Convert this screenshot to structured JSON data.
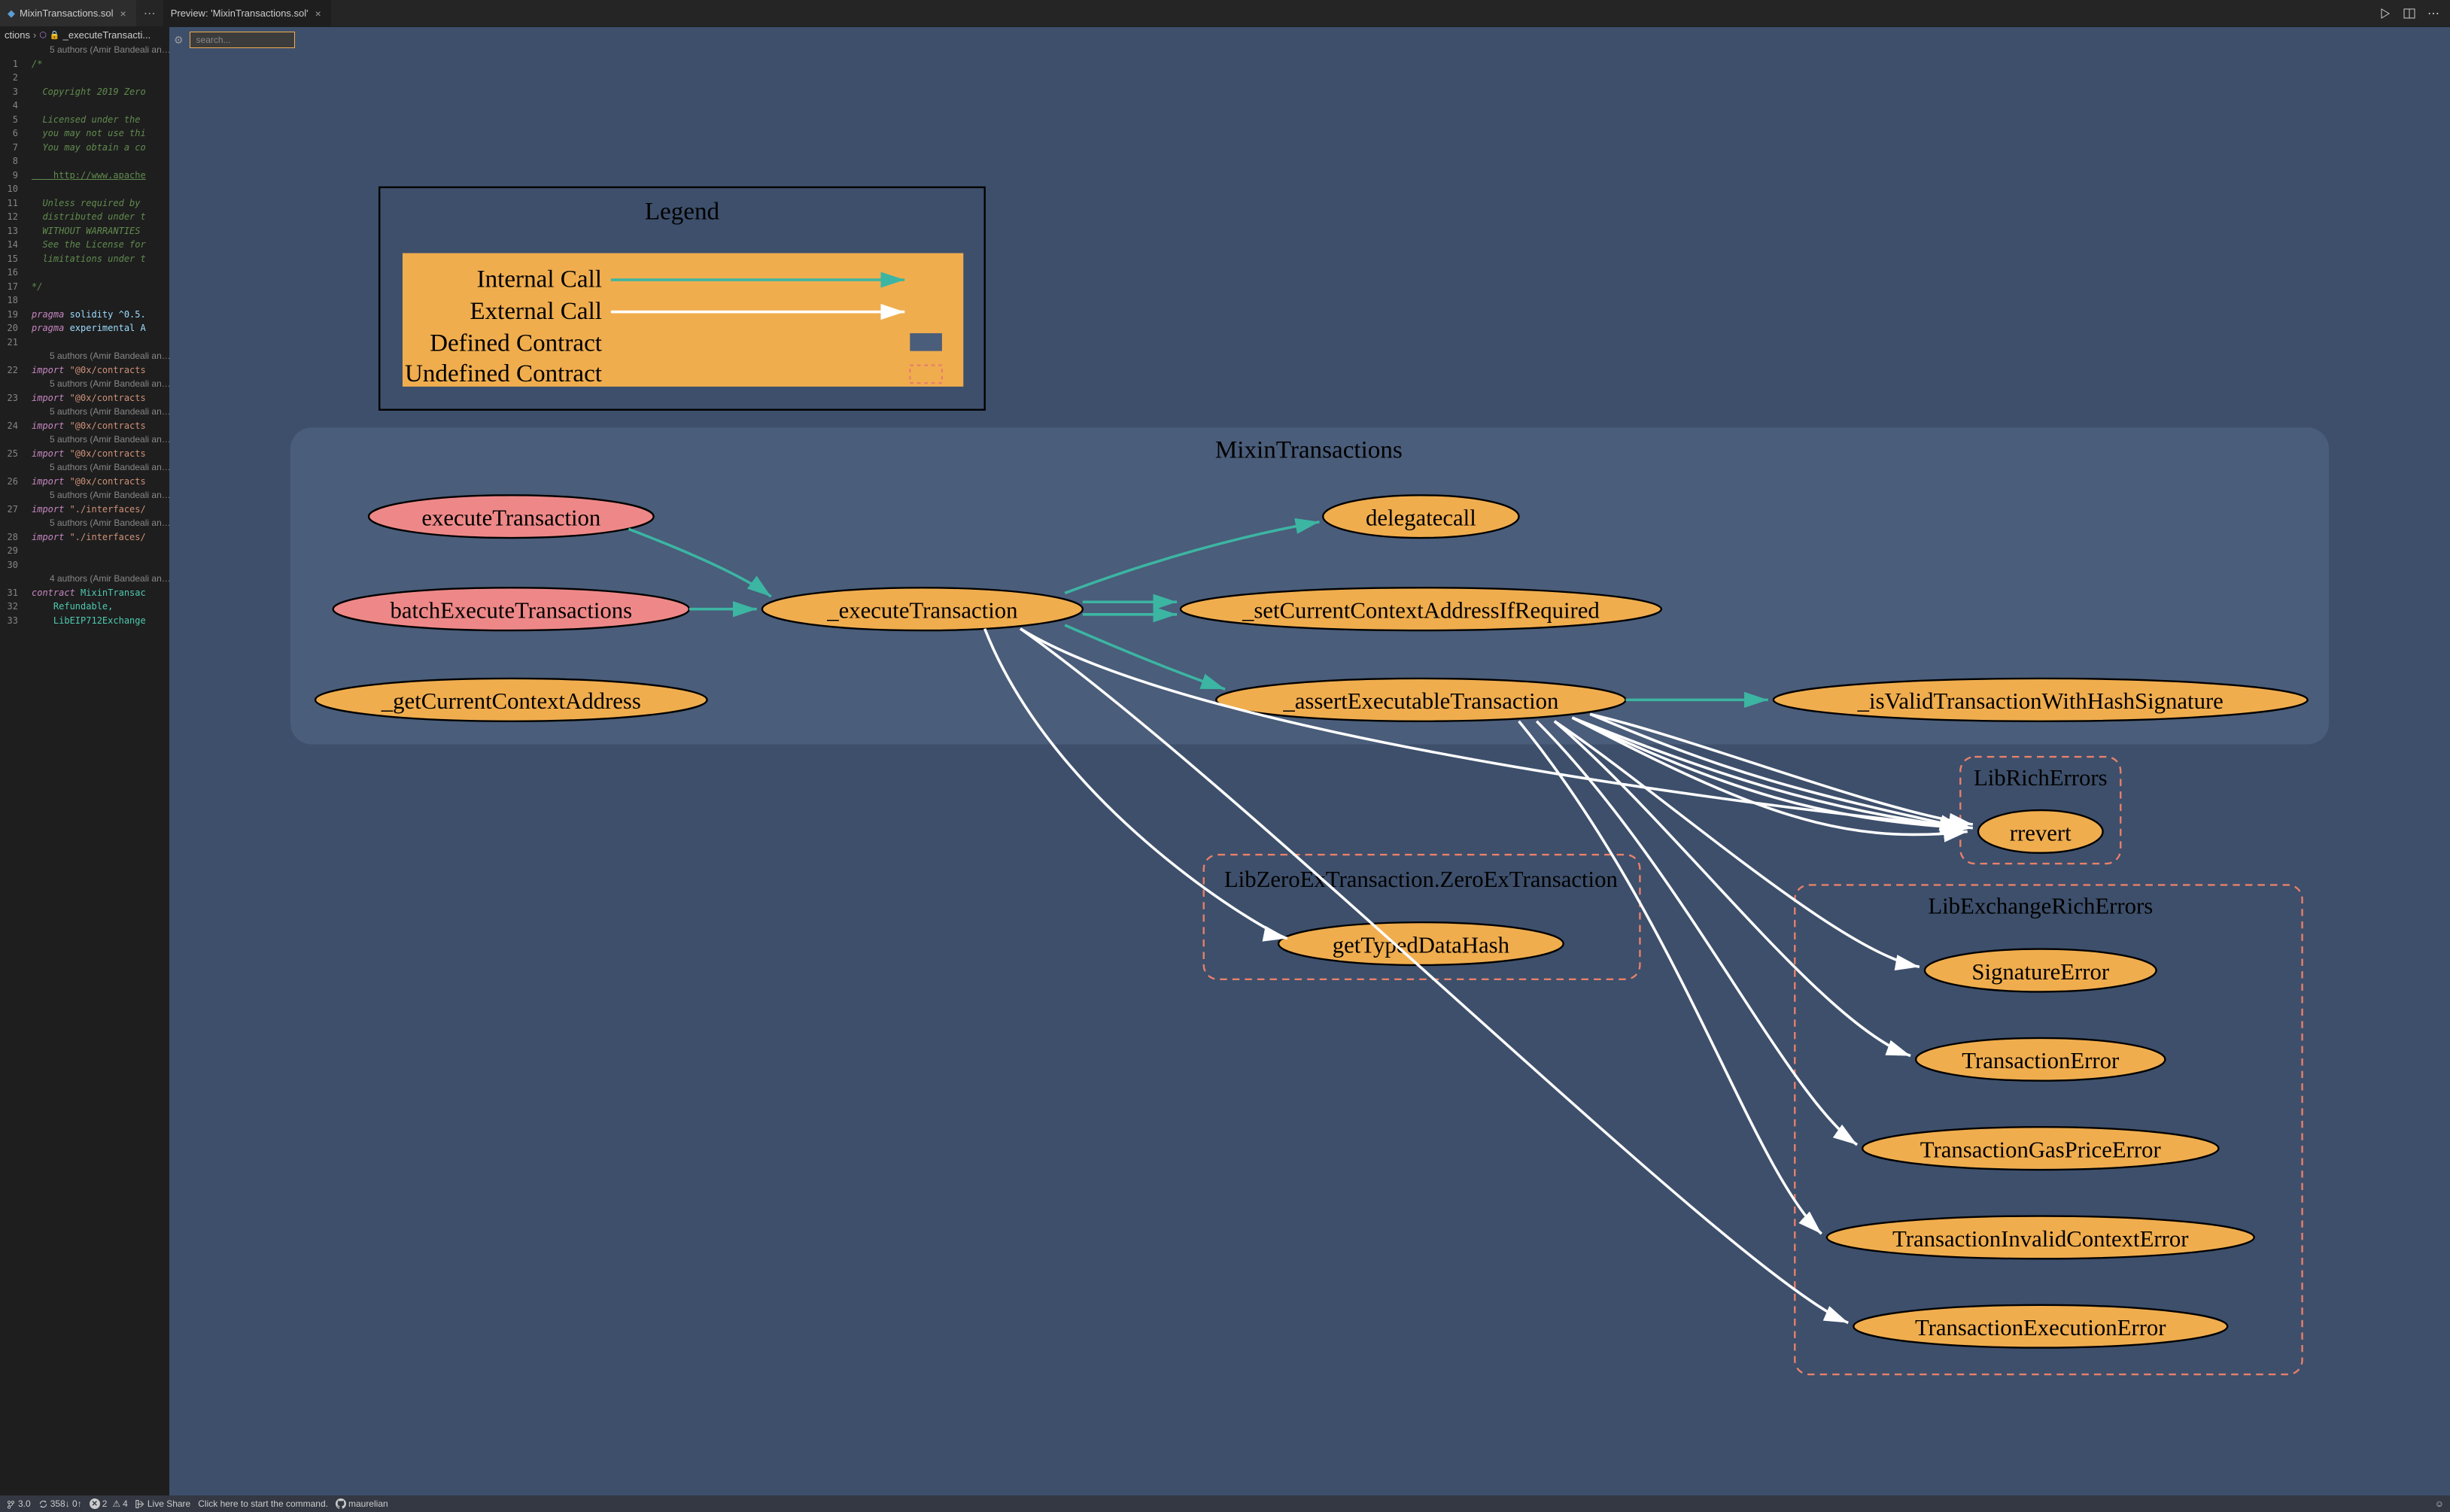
{
  "tabs": {
    "first": "MixinTransactions.sol",
    "second": "Preview: 'MixinTransactions.sol'"
  },
  "breadcrumb": {
    "prefix": "ctions",
    "symbol": "_executeTransacti..."
  },
  "search": {
    "placeholder": "search..."
  },
  "editor": {
    "authors5": "5 authors (Amir Bandeali an…",
    "authors4": "4 authors (Amir Bandeali an…",
    "lines": {
      "l1": "/*",
      "l3": "  Copyright 2019 Zero",
      "l5": "  Licensed under the ",
      "l6": "  you may not use thi",
      "l7": "  You may obtain a co",
      "l9": "    http://www.apache",
      "l11": "  Unless required by ",
      "l12": "  distributed under t",
      "l13": "  WITHOUT WARRANTIES ",
      "l14": "  See the License for",
      "l15": "  limitations under t",
      "l17": "*/",
      "l19_kw": "pragma",
      "l19_rest": " solidity ^0.5.",
      "l20_kw": "pragma",
      "l20_rest": " experimental A",
      "l22_kw": "import",
      "l22_str": " \"@0x/contracts",
      "l23_kw": "import",
      "l23_str": " \"@0x/contracts",
      "l24_kw": "import",
      "l24_str": " \"@0x/contracts",
      "l25_kw": "import",
      "l25_str": " \"@0x/contracts",
      "l26_kw": "import",
      "l26_str": " \"@0x/contracts",
      "l27_kw": "import",
      "l27_str": " \"./interfaces/",
      "l28_kw": "import",
      "l28_str": " \"./interfaces/",
      "l31_kw": "contract",
      "l31_rest": " MixinTransac",
      "l32": "    Refundable,",
      "l33": "    LibEIP712Exchange"
    }
  },
  "graph": {
    "legend": {
      "title": "Legend",
      "internal": "Internal Call",
      "external": "External Call",
      "defined": "Defined Contract",
      "undefined": "Undefined Contract"
    },
    "cluster_main": "MixinTransactions",
    "cluster_libze": "LibZeroExTransaction.ZeroExTransaction",
    "cluster_librich": "LibRichErrors",
    "cluster_libexrich": "LibExchangeRichErrors",
    "nodes": {
      "executeTransaction": "executeTransaction",
      "batchExecuteTransactions": "batchExecuteTransactions",
      "getCurrentContextAddress": "_getCurrentContextAddress",
      "executeTransactionInternal": "_executeTransaction",
      "delegatecall": "delegatecall",
      "setCurrentContext": "_setCurrentContextAddressIfRequired",
      "assertExecutable": "_assertExecutableTransaction",
      "isValidSig": "_isValidTransactionWithHashSignature",
      "getTypedDataHash": "getTypedDataHash",
      "rrevert": "rrevert",
      "SignatureError": "SignatureError",
      "TransactionError": "TransactionError",
      "TransactionGasPriceError": "TransactionGasPriceError",
      "TransactionInvalidContextError": "TransactionInvalidContextError",
      "TransactionExecutionError": "TransactionExecutionError"
    }
  },
  "status": {
    "branch": "3.0",
    "sync": "358↓ 0↑",
    "errors": "2",
    "warnings": "4",
    "liveshare": "Live Share",
    "command_prompt": "Click here to start the command.",
    "github": "maurelian"
  }
}
